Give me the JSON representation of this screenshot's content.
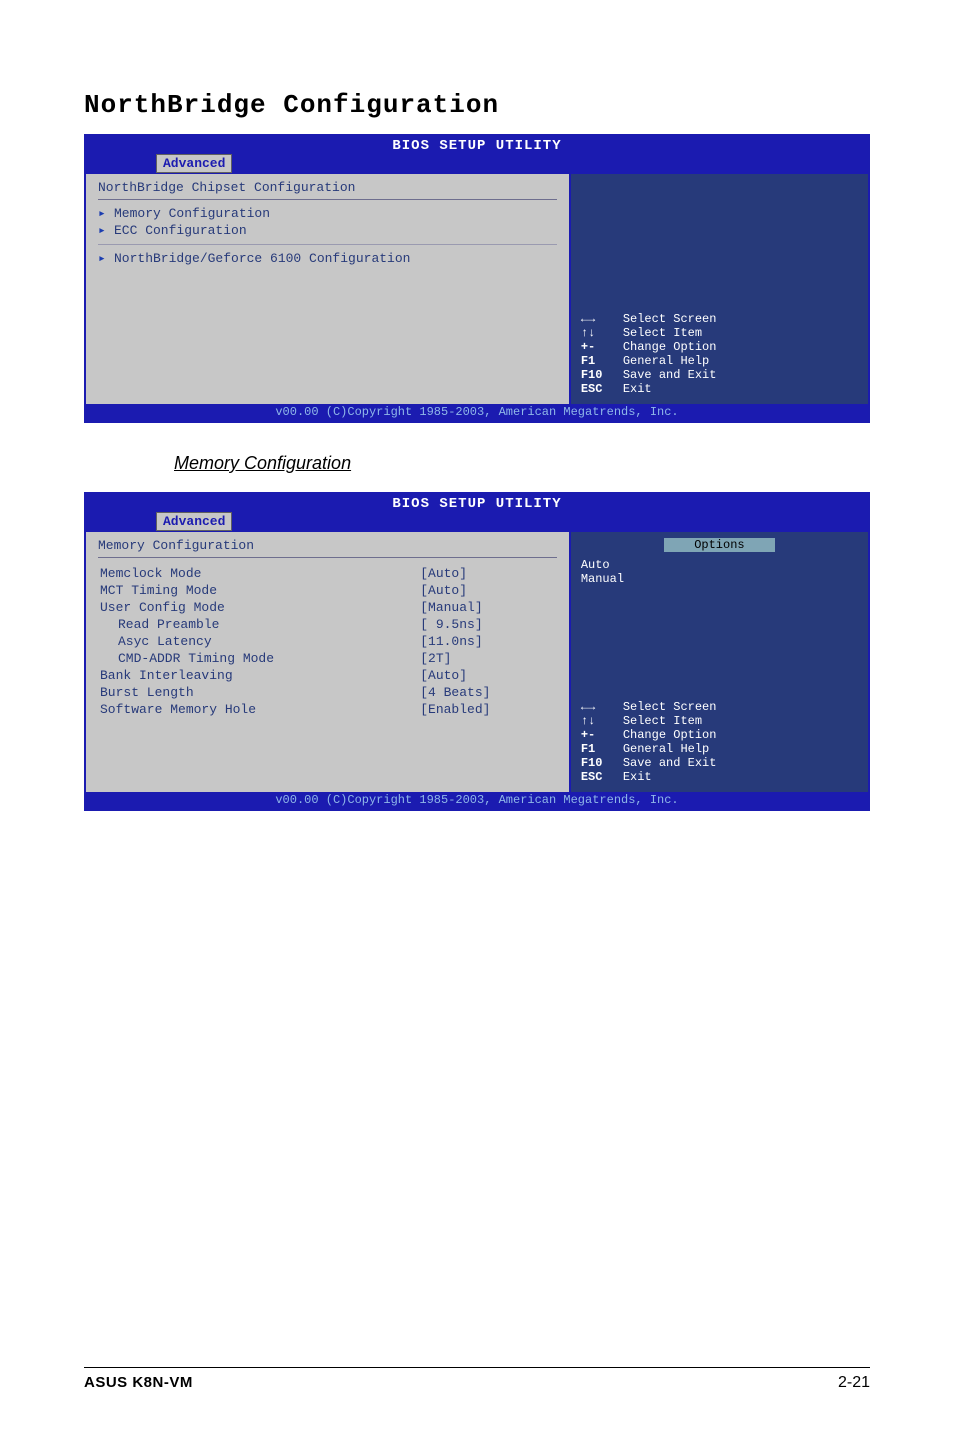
{
  "section_title": "NorthBridge Configuration",
  "bios1": {
    "title": "BIOS SETUP UTILITY",
    "tab": "Advanced",
    "heading": "NorthBridge Chipset Configuration",
    "items": [
      "Memory Configuration",
      "ECC Configuration",
      "NorthBridge/Geforce 6100 Configuration"
    ],
    "keys": [
      {
        "k": "←→",
        "d": "Select Screen"
      },
      {
        "k": "↑↓",
        "d": "Select Item"
      },
      {
        "k": "+-",
        "d": "Change Option"
      },
      {
        "k": "F1",
        "d": "General Help"
      },
      {
        "k": "F10",
        "d": "Save and Exit"
      },
      {
        "k": "ESC",
        "d": "Exit"
      }
    ],
    "footer": "v00.00 (C)Copyright 1985-2003, American Megatrends, Inc."
  },
  "subsection_title": "Memory Configuration",
  "bios2": {
    "title": "BIOS SETUP UTILITY",
    "tab": "Advanced",
    "heading": "Memory Configuration",
    "options_label": "Options",
    "options_values": [
      "Auto",
      "Manual"
    ],
    "rows": [
      {
        "label": "Memclock Mode",
        "value": "[Auto]",
        "indent": false
      },
      {
        "label": "MCT Timing Mode",
        "value": "[Auto]",
        "indent": false
      },
      {
        "label": "User Config Mode",
        "value": "[Manual]",
        "indent": false
      },
      {
        "label": "Read Preamble",
        "value": "[ 9.5ns]",
        "indent": true
      },
      {
        "label": "Asyc Latency",
        "value": "[11.0ns]",
        "indent": true
      },
      {
        "label": "CMD-ADDR Timing Mode",
        "value": "[2T]",
        "indent": true
      },
      {
        "label": "Bank Interleaving",
        "value": "[Auto]",
        "indent": false
      },
      {
        "label": "Burst Length",
        "value": "[4 Beats]",
        "indent": false
      },
      {
        "label": "Software Memory Hole",
        "value": "[Enabled]",
        "indent": false
      }
    ],
    "keys": [
      {
        "k": "←→",
        "d": "Select Screen"
      },
      {
        "k": "↑↓",
        "d": "Select Item"
      },
      {
        "k": "+-",
        "d": "Change Option"
      },
      {
        "k": "F1",
        "d": "General Help"
      },
      {
        "k": "F10",
        "d": "Save and Exit"
      },
      {
        "k": "ESC",
        "d": "Exit"
      }
    ],
    "footer": "v00.00 (C)Copyright 1985-2003, American Megatrends, Inc."
  },
  "page_footer": {
    "left": "ASUS K8N-VM",
    "right": "2-21"
  }
}
